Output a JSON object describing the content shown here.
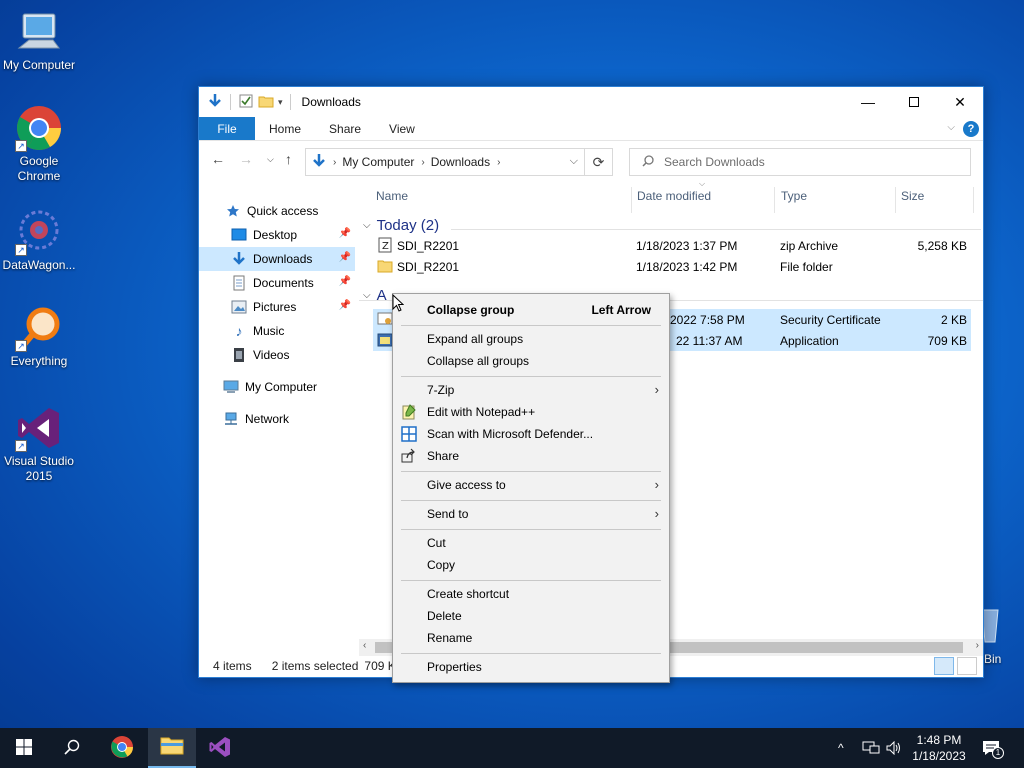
{
  "desktop": {
    "icons": [
      {
        "label": "My Computer"
      },
      {
        "label": "Google Chrome"
      },
      {
        "label": "DataWagon..."
      },
      {
        "label": "Everything"
      },
      {
        "label": "Visual Studio 2015"
      }
    ],
    "recycle_bin_label": "Bin"
  },
  "window": {
    "title": "Downloads",
    "ribbon_tabs": [
      "File",
      "Home",
      "Share",
      "View"
    ],
    "help_glyph": "?",
    "address": {
      "crumbs": [
        "My Computer",
        "Downloads"
      ]
    },
    "search_placeholder": "Search Downloads",
    "nav": [
      {
        "label": "Quick access",
        "icon": "star-icon"
      },
      {
        "label": "Desktop",
        "icon": "desktop-icon",
        "pinned": true
      },
      {
        "label": "Downloads",
        "icon": "download-arrow-icon",
        "pinned": true,
        "selected": true
      },
      {
        "label": "Documents",
        "icon": "document-icon",
        "pinned": true
      },
      {
        "label": "Pictures",
        "icon": "picture-icon",
        "pinned": true
      },
      {
        "label": "Music",
        "icon": "music-icon"
      },
      {
        "label": "Videos",
        "icon": "video-icon"
      },
      {
        "label": "My Computer",
        "icon": "computer-icon"
      },
      {
        "label": "Network",
        "icon": "network-icon"
      }
    ],
    "columns": [
      "Name",
      "Date modified",
      "Type",
      "Size"
    ],
    "groups": [
      {
        "label": "Today (2)"
      },
      {
        "label": "A"
      }
    ],
    "files": [
      {
        "name": "SDI_R2201",
        "date": "1/18/2023 1:37 PM",
        "type": "zip Archive",
        "size": "5,258 KB",
        "selected": false,
        "icon": "zip-icon"
      },
      {
        "name": "SDI_R2201",
        "date": "1/18/2023 1:42 PM",
        "type": "File folder",
        "size": "",
        "selected": false,
        "icon": "folder-icon"
      },
      {
        "name": "",
        "date": "2022 7:58 PM",
        "type": "Security Certificate",
        "size": "2 KB",
        "selected": true,
        "icon": "certificate-icon"
      },
      {
        "name": "",
        "date": "22 11:37 AM",
        "type": "Application",
        "size": "709 KB",
        "selected": true,
        "icon": "application-icon"
      }
    ],
    "status": {
      "item_count": "4 items",
      "selected_count": "2 items selected",
      "selected_size": "709 K"
    }
  },
  "context_menu": {
    "items": [
      {
        "label": "Collapse group",
        "shortcut": "Left Arrow",
        "bold": true
      },
      {
        "sep": true
      },
      {
        "label": "Expand all groups"
      },
      {
        "label": "Collapse all groups"
      },
      {
        "sep": true
      },
      {
        "label": "7-Zip",
        "submenu": true
      },
      {
        "label": "Edit with Notepad++",
        "icon": "notepad-plus-icon"
      },
      {
        "label": "Scan with Microsoft Defender...",
        "icon": "defender-shield-icon"
      },
      {
        "label": "Share",
        "icon": "share-icon"
      },
      {
        "sep": true
      },
      {
        "label": "Give access to",
        "submenu": true
      },
      {
        "sep": true
      },
      {
        "label": "Send to",
        "submenu": true
      },
      {
        "sep": true
      },
      {
        "label": "Cut"
      },
      {
        "label": "Copy"
      },
      {
        "sep": true
      },
      {
        "label": "Create shortcut"
      },
      {
        "label": "Delete"
      },
      {
        "label": "Rename"
      },
      {
        "sep": true
      },
      {
        "label": "Properties"
      }
    ]
  },
  "taskbar": {
    "clock_time": "1:48 PM",
    "clock_date": "1/18/2023",
    "notification_count": "1"
  },
  "colors": {
    "accent": "#1979ca",
    "selection": "#cce8ff",
    "taskbar": "#101a28"
  }
}
